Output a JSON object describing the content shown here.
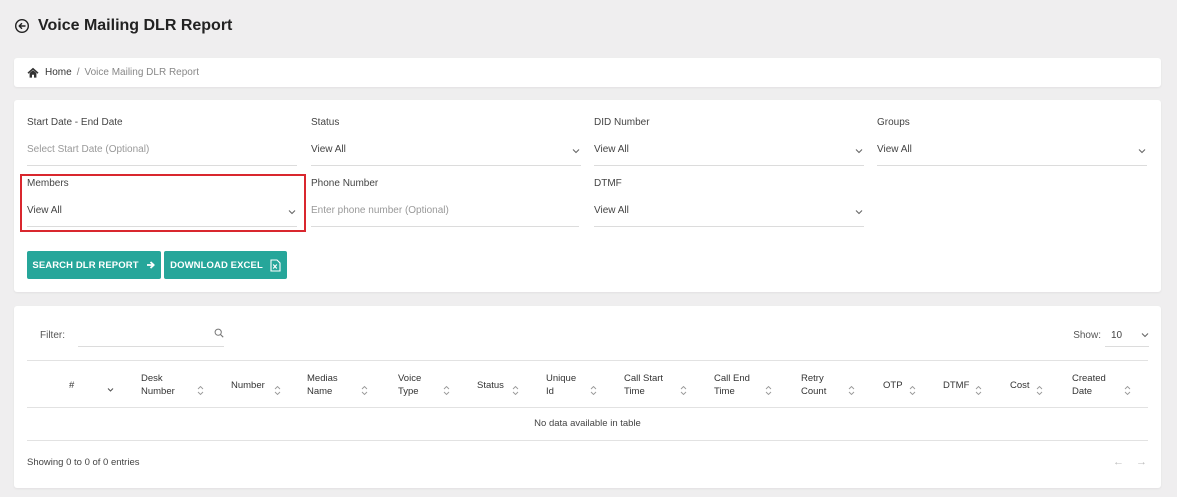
{
  "header": {
    "title": "Voice Mailing DLR Report"
  },
  "breadcrumb": {
    "home": "Home",
    "separator": "/",
    "current": "Voice Mailing DLR Report"
  },
  "filters": {
    "date_range": {
      "label": "Start Date - End Date",
      "placeholder": "Select Start Date (Optional)"
    },
    "status": {
      "label": "Status",
      "value": "View All"
    },
    "did_number": {
      "label": "DID Number",
      "value": "View All"
    },
    "groups": {
      "label": "Groups",
      "value": "View All"
    },
    "members": {
      "label": "Members",
      "value": "View All"
    },
    "phone_number": {
      "label": "Phone Number",
      "placeholder": "Enter phone number (Optional)"
    },
    "dtmf": {
      "label": "DTMF",
      "value": "View All"
    }
  },
  "actions": {
    "search_label": "SEARCH DLR REPORT",
    "excel_label": "DOWNLOAD EXCEL"
  },
  "table": {
    "filter_label": "Filter:",
    "show_label": "Show:",
    "page_size": "10",
    "columns": [
      [
        "#"
      ],
      [
        "Desk",
        "Number"
      ],
      [
        "Number"
      ],
      [
        "Medias",
        "Name"
      ],
      [
        "Voice",
        "Type"
      ],
      [
        "Status"
      ],
      [
        "Unique",
        "Id"
      ],
      [
        "Call Start",
        "Time"
      ],
      [
        "Call End",
        "Time"
      ],
      [
        "Retry",
        "Count"
      ],
      [
        "OTP"
      ],
      [
        "DTMF"
      ],
      [
        "Cost"
      ],
      [
        "Created",
        "Date"
      ]
    ],
    "empty_message": "No data available in table",
    "info": "Showing 0 to 0 of 0 entries",
    "prev": "←",
    "next": "→"
  },
  "colors": {
    "accent": "#26a69a",
    "highlight": "#d9272e",
    "background": "#efeeef"
  }
}
